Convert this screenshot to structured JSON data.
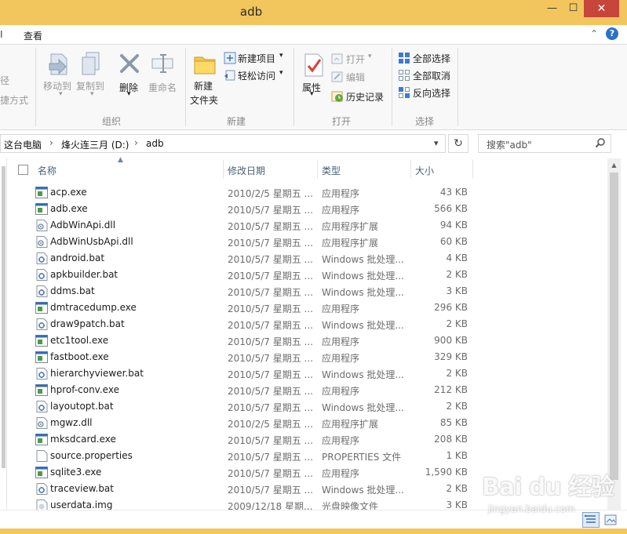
{
  "window": {
    "title": "adb",
    "minimize": "—",
    "maximize": "☐",
    "close": "✕"
  },
  "ribbon_tabs": {
    "left_mark": "Ι",
    "view": "查看"
  },
  "ribbon": {
    "cut_partial_1": "径",
    "cut_partial_2": "捷方式",
    "move_to": "移动到",
    "copy_to": "复制到",
    "delete": "删除",
    "rename": "重命名",
    "group_organize": "组织",
    "new_folder_line1": "新建",
    "new_folder_line2": "文件夹",
    "new_item": "新建项目",
    "easy_access": "轻松访问",
    "group_new": "新建",
    "properties": "属性",
    "open": "打开",
    "edit": "编辑",
    "history": "历史记录",
    "group_open": "打开",
    "select_all": "全部选择",
    "select_none": "全部取消",
    "invert_selection": "反向选择",
    "group_select": "选择"
  },
  "address": {
    "crumb_pc": "这台电脑",
    "crumb_drive": "烽火连三月 (D:)",
    "crumb_folder": "adb",
    "search_placeholder": "搜索\"adb\""
  },
  "columns": {
    "name": "名称",
    "date": "修改日期",
    "type": "类型",
    "size": "大小"
  },
  "files": [
    {
      "name": "acp.exe",
      "date": "2010/2/5 星期五 ...",
      "type": "应用程序",
      "size": "43 KB",
      "icon": "exe"
    },
    {
      "name": "adb.exe",
      "date": "2010/5/7 星期五 ...",
      "type": "应用程序",
      "size": "566 KB",
      "icon": "exe"
    },
    {
      "name": "AdbWinApi.dll",
      "date": "2010/5/7 星期五 ...",
      "type": "应用程序扩展",
      "size": "94 KB",
      "icon": "dll"
    },
    {
      "name": "AdbWinUsbApi.dll",
      "date": "2010/5/7 星期五 ...",
      "type": "应用程序扩展",
      "size": "60 KB",
      "icon": "dll"
    },
    {
      "name": "android.bat",
      "date": "2010/5/7 星期五 ...",
      "type": "Windows 批处理...",
      "size": "4 KB",
      "icon": "bat"
    },
    {
      "name": "apkbuilder.bat",
      "date": "2010/5/7 星期五 ...",
      "type": "Windows 批处理...",
      "size": "2 KB",
      "icon": "bat"
    },
    {
      "name": "ddms.bat",
      "date": "2010/5/7 星期五 ...",
      "type": "Windows 批处理...",
      "size": "3 KB",
      "icon": "bat"
    },
    {
      "name": "dmtracedump.exe",
      "date": "2010/5/7 星期五 ...",
      "type": "应用程序",
      "size": "296 KB",
      "icon": "exe"
    },
    {
      "name": "draw9patch.bat",
      "date": "2010/5/7 星期五 ...",
      "type": "Windows 批处理...",
      "size": "2 KB",
      "icon": "bat"
    },
    {
      "name": "etc1tool.exe",
      "date": "2010/5/7 星期五 ...",
      "type": "应用程序",
      "size": "900 KB",
      "icon": "exe"
    },
    {
      "name": "fastboot.exe",
      "date": "2010/5/7 星期五 ...",
      "type": "应用程序",
      "size": "329 KB",
      "icon": "exe"
    },
    {
      "name": "hierarchyviewer.bat",
      "date": "2010/5/7 星期五 ...",
      "type": "Windows 批处理...",
      "size": "2 KB",
      "icon": "bat"
    },
    {
      "name": "hprof-conv.exe",
      "date": "2010/5/7 星期五 ...",
      "type": "应用程序",
      "size": "212 KB",
      "icon": "exe"
    },
    {
      "name": "layoutopt.bat",
      "date": "2010/5/7 星期五 ...",
      "type": "Windows 批处理...",
      "size": "2 KB",
      "icon": "bat"
    },
    {
      "name": "mgwz.dll",
      "date": "2010/2/5 星期五 ...",
      "type": "应用程序扩展",
      "size": "85 KB",
      "icon": "dll"
    },
    {
      "name": "mksdcard.exe",
      "date": "2010/5/7 星期五 ...",
      "type": "应用程序",
      "size": "208 KB",
      "icon": "exe"
    },
    {
      "name": "source.properties",
      "date": "2010/5/7 星期五 ...",
      "type": "PROPERTIES 文件",
      "size": "1 KB",
      "icon": "file"
    },
    {
      "name": "sqlite3.exe",
      "date": "2010/5/7 星期五 ...",
      "type": "应用程序",
      "size": "1,590 KB",
      "icon": "exe"
    },
    {
      "name": "traceview.bat",
      "date": "2010/5/7 星期五 ...",
      "type": "Windows 批处理...",
      "size": "2 KB",
      "icon": "bat"
    },
    {
      "name": "userdata.img",
      "date": "2009/12/18 星期...",
      "type": "光盘映像文件",
      "size": "3 KB",
      "icon": "img"
    }
  ],
  "watermark": {
    "logo": "Bai du 经验",
    "url": "jingyan.baidu.com"
  },
  "colors": {
    "title_bar": "#f2c55d",
    "close_button": "#c7453a",
    "header_text": "#4c607a",
    "secondary_text": "#6d6d6d"
  }
}
